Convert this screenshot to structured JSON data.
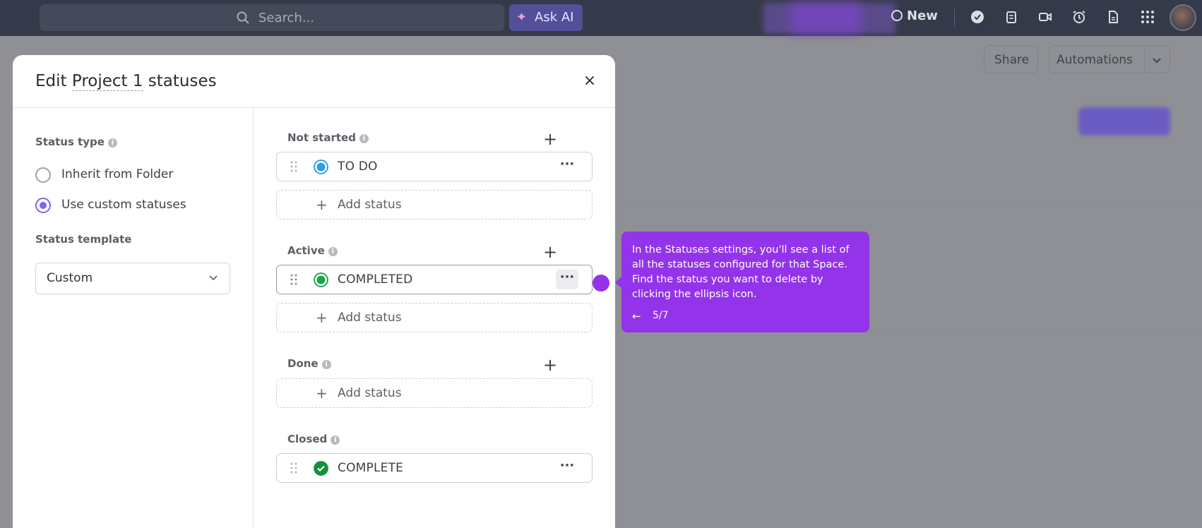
{
  "topbar": {
    "search_placeholder": "Search...",
    "ask_ai_label": "Ask AI",
    "new_label": "New",
    "icons": [
      "check-circle-icon",
      "clipboard-icon",
      "video-icon",
      "alarm-icon",
      "document-icon",
      "apps-grid-icon"
    ]
  },
  "background": {
    "share_label": "Share",
    "automations_label": "Automations"
  },
  "modal": {
    "title_prefix": "Edit ",
    "title_project": "Project 1",
    "title_suffix": " statuses",
    "close_label": "×",
    "status_type_label": "Status type",
    "options": [
      {
        "label": "Inherit from Folder",
        "selected": false
      },
      {
        "label": "Use custom statuses",
        "selected": true
      }
    ],
    "status_template_label": "Status template",
    "template_value": "Custom",
    "groups": {
      "not_started": {
        "label": "Not started",
        "statuses": [
          {
            "name": "TO DO",
            "color": "#2f9bea"
          }
        ],
        "add_label": "Add status"
      },
      "active": {
        "label": "Active",
        "statuses": [
          {
            "name": "COMPLETED",
            "color": "#1aa34a"
          }
        ],
        "add_label": "Add status"
      },
      "done": {
        "label": "Done",
        "add_label": "Add status"
      },
      "closed": {
        "label": "Closed",
        "statuses": [
          {
            "name": "COMPLETE",
            "color": "#15913c"
          }
        ]
      }
    }
  },
  "tooltip": {
    "text": "In the Statuses settings, you'll see a list of all the statuses configured for that Space. Find the status you want to delete by clicking the ellipsis icon.",
    "back_label": "←",
    "step": "5/7"
  },
  "colors": {
    "accent": "#7b68ee",
    "tooltip": "#9333ea",
    "topbar": "#353a4a"
  }
}
